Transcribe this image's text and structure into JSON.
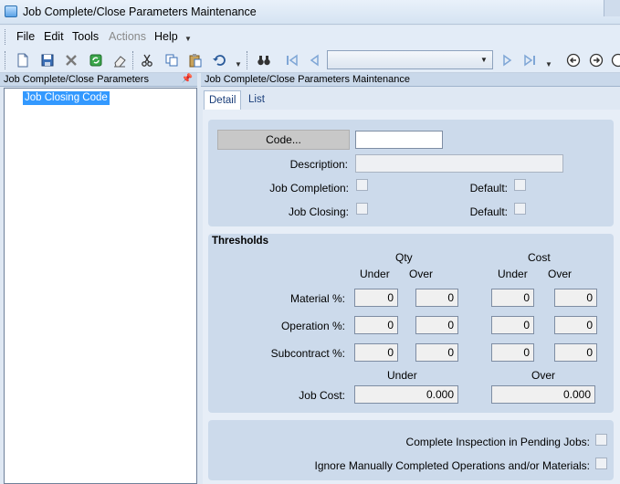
{
  "window": {
    "title": "Job Complete/Close Parameters Maintenance"
  },
  "menu": {
    "items": [
      "File",
      "Edit",
      "Tools",
      "Actions",
      "Help"
    ]
  },
  "left_panel": {
    "title": "Job Complete/Close Parameters",
    "tree_items": [
      "Job Closing Code"
    ]
  },
  "right_panel": {
    "title": "Job Complete/Close Parameters Maintenance",
    "tabs": [
      "Detail",
      "List"
    ]
  },
  "form": {
    "code_button": "Code...",
    "code_value": "",
    "description_label": "Description:",
    "description_value": "",
    "job_completion_label": "Job Completion:",
    "job_closing_label": "Job Closing:",
    "default_label": "Default:",
    "default2_label": "Default:"
  },
  "thresholds": {
    "title": "Thresholds",
    "qty_label": "Qty",
    "cost_label": "Cost",
    "under_label": "Under",
    "over_label": "Over",
    "rows": [
      {
        "label": "Material %:",
        "qty_under": "0",
        "qty_over": "0",
        "cost_under": "0",
        "cost_over": "0"
      },
      {
        "label": "Operation %:",
        "qty_under": "0",
        "qty_over": "0",
        "cost_under": "0",
        "cost_over": "0"
      },
      {
        "label": "Subcontract %:",
        "qty_under": "0",
        "qty_over": "0",
        "cost_under": "0",
        "cost_over": "0"
      }
    ],
    "job_cost_under_label": "Under",
    "job_cost_over_label": "Over",
    "job_cost_label": "Job Cost:",
    "job_cost_under": "0.000",
    "job_cost_over": "0.000"
  },
  "options": {
    "complete_inspection_label": "Complete Inspection in Pending Jobs:",
    "ignore_manual_label": "Ignore Manually Completed Operations and/or Materials:"
  }
}
